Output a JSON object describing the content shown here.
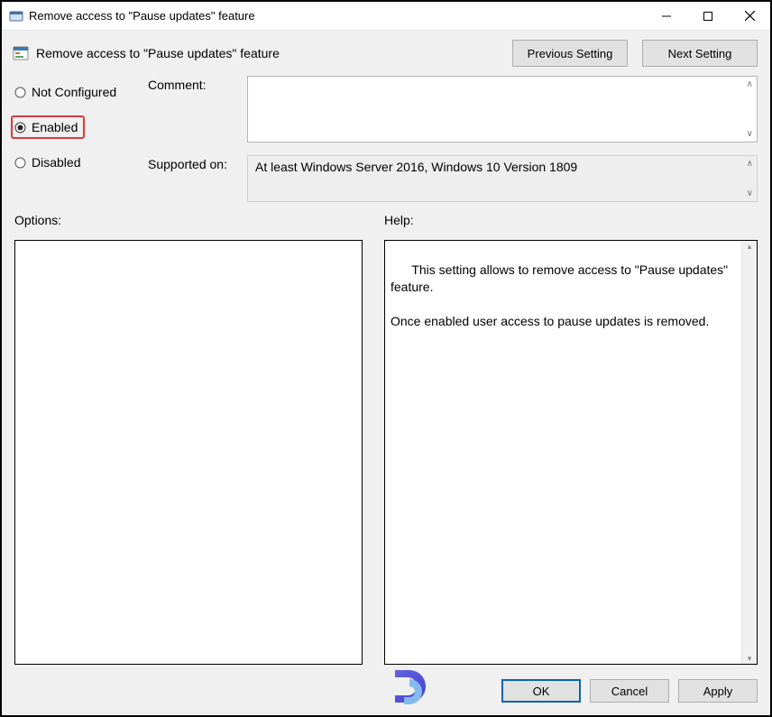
{
  "window": {
    "title": "Remove access to \"Pause updates\" feature",
    "min_icon": "minimize",
    "max_icon": "maximize",
    "close_icon": "close"
  },
  "header": {
    "title": "Remove access to \"Pause updates\" feature",
    "prev_btn": "Previous Setting",
    "next_btn": "Next Setting"
  },
  "radio": {
    "not_configured": "Not Configured",
    "enabled": "Enabled",
    "disabled": "Disabled",
    "selected": "enabled"
  },
  "fields": {
    "comment_label": "Comment:",
    "comment_value": "",
    "supported_label": "Supported on:",
    "supported_value": "At least Windows Server 2016, Windows 10 Version 1809"
  },
  "labels": {
    "options": "Options:",
    "help": "Help:"
  },
  "help_text": "This setting allows to remove access to \"Pause updates\" feature.\n\nOnce enabled user access to pause updates is removed.",
  "buttons": {
    "ok": "OK",
    "cancel": "Cancel",
    "apply": "Apply"
  }
}
